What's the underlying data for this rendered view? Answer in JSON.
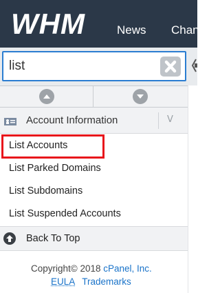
{
  "header": {
    "logo_text": "WHM",
    "nav": [
      "News",
      "Changes"
    ]
  },
  "search": {
    "value": "list",
    "placeholder": ""
  },
  "section": {
    "title": "Account Information",
    "chevron": "V"
  },
  "menu_items": [
    {
      "label": "List Accounts"
    },
    {
      "label": "List Parked Domains"
    },
    {
      "label": "List Subdomains"
    },
    {
      "label": "List Suspended Accounts"
    }
  ],
  "back_to_top": "Back To Top",
  "footer": {
    "copyright": "Copyright© 2018 ",
    "cpanel": "cPanel, Inc.",
    "eula": "EULA",
    "trademarks": "Trademarks"
  },
  "colors": {
    "header_bg": "#2b3848",
    "accent": "#2a7dd1",
    "highlight": "#e8141b"
  }
}
